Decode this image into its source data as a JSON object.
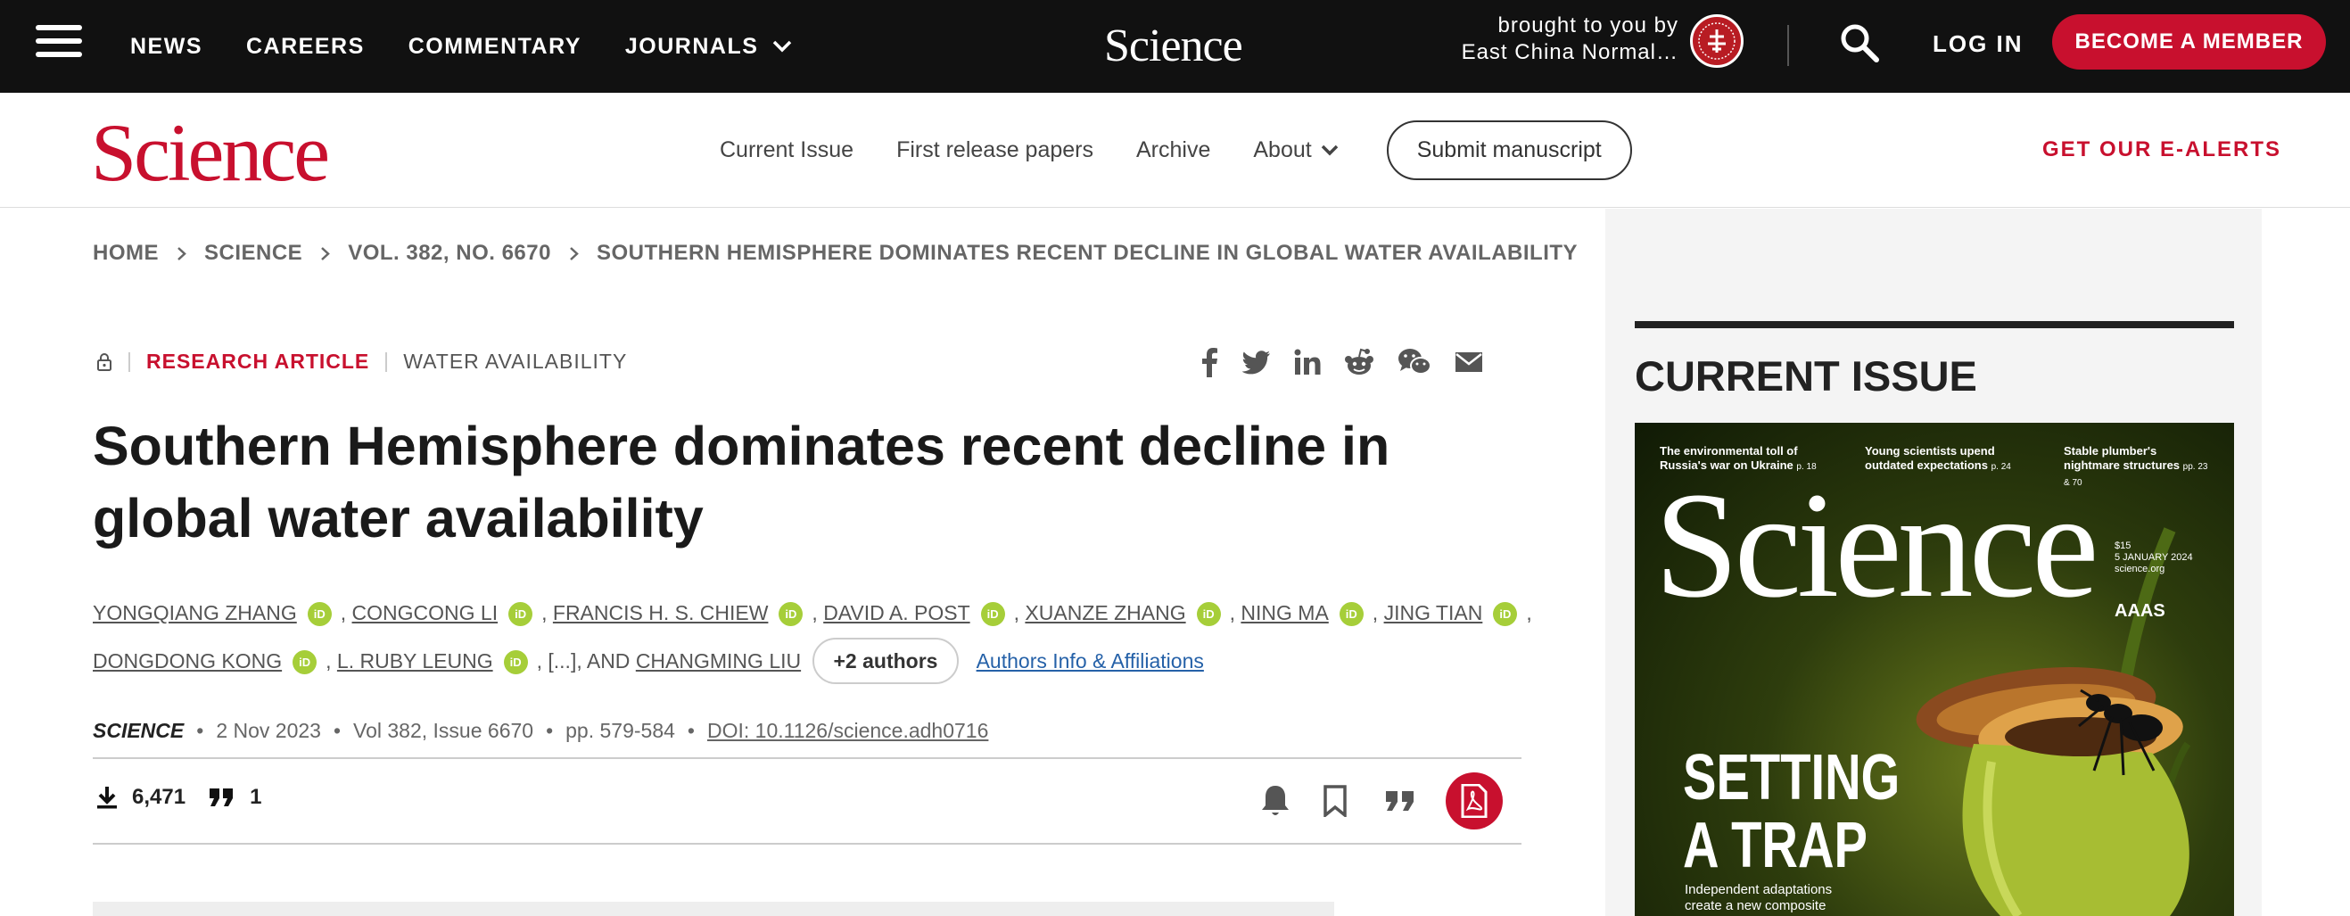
{
  "topbar": {
    "nav": [
      "NEWS",
      "CAREERS",
      "COMMENTARY",
      "JOURNALS"
    ],
    "logo": "Science",
    "brought_line1": "brought to you by",
    "brought_line2": "East China Normal…",
    "login": "LOG IN",
    "member": "BECOME A MEMBER"
  },
  "secbar": {
    "logo": "Science",
    "nav": [
      "Current Issue",
      "First release papers",
      "Archive",
      "About"
    ],
    "submit": "Submit manuscript",
    "ealerts": "GET OUR E-ALERTS"
  },
  "breadcrumb": [
    "HOME",
    "SCIENCE",
    "VOL. 382, NO. 6670",
    "SOUTHERN HEMISPHERE DOMINATES RECENT DECLINE IN GLOBAL WATER AVAILABILITY"
  ],
  "article": {
    "type": "RESEARCH ARTICLE",
    "topic": "WATER AVAILABILITY",
    "title": "Southern Hemisphere dominates recent decline in global water availability",
    "authors": [
      "YONGQIANG ZHANG",
      "CONGCONG LI",
      "FRANCIS H. S. CHIEW",
      "DAVID A. POST",
      "XUANZE ZHANG",
      "NING MA",
      "JING TIAN",
      "DONGDONG KONG",
      "L. RUBY LEUNG"
    ],
    "orcid_label": "iD",
    "ellipsis": "[...]",
    "and_text": ", AND ",
    "last_author": "CHANGMING LIU",
    "more_authors": "+2 authors",
    "affiliations": "Authors Info & Affiliations",
    "journal": "SCIENCE",
    "date": "2 Nov 2023",
    "volume": "Vol 382, Issue 6670",
    "pages": "pp. 579-584",
    "doi": "DOI: 10.1126/science.adh0716",
    "downloads": "6,471",
    "citations": "1"
  },
  "sidebar": {
    "heading": "CURRENT ISSUE",
    "cover": {
      "headline1": "The environmental toll of Russia's war on Ukraine",
      "headline1_page": "p. 18",
      "headline2": "Young scientists upend outdated expectations",
      "headline2_page": "p. 24",
      "headline3": "Stable plumber's nightmare structures",
      "headline3_page": "pp. 23 & 70",
      "logo": "Science",
      "price": "$15",
      "date": "5 JANUARY 2024",
      "site": "science.org",
      "aaas": "AAAS",
      "cover_title_1": "SETTING",
      "cover_title_2": "A TRAP",
      "cover_sub": "Independent adaptations create a new composite trait"
    }
  },
  "colors": {
    "brand_red": "#c8102e",
    "topbar_bg": "#111111",
    "orcid_green": "#a6ce39",
    "link_blue": "#2561a8"
  }
}
